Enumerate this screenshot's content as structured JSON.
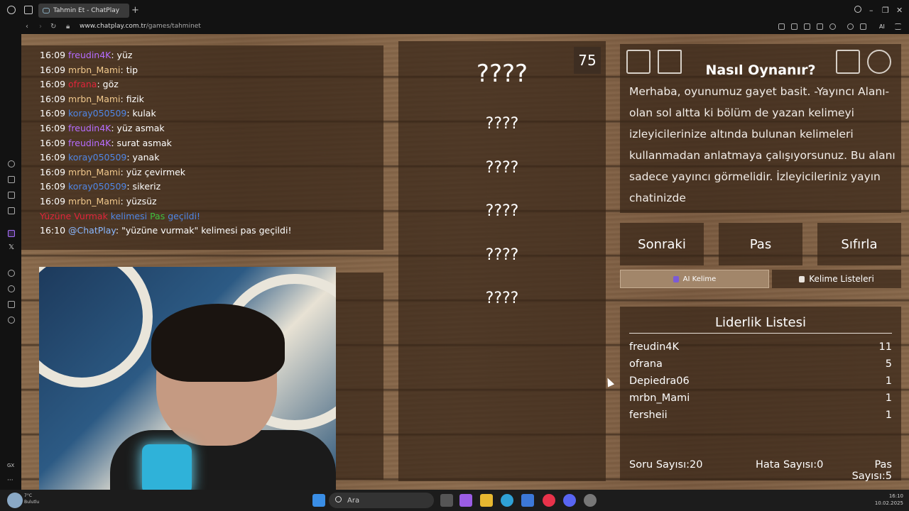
{
  "browser": {
    "tab_title": "Tahmin Et - ChatPlay",
    "tab_plus": "+",
    "url_domain": "www.chatplay.com.tr",
    "url_path": "/games/tahminet",
    "ai_label": "AI",
    "left_gx": "GX"
  },
  "chat": {
    "messages": [
      {
        "time": "16:09",
        "user": "freudin4K",
        "color": "#b66cff",
        "text": ": yüz"
      },
      {
        "time": "16:09",
        "user": "mrbn_Mami",
        "color": "#f0c88c",
        "text": ": tip"
      },
      {
        "time": "16:09",
        "user": "ofrana",
        "color": "#e0253a",
        "text": ": göz"
      },
      {
        "time": "16:09",
        "user": "mrbn_Mami",
        "color": "#f0c88c",
        "text": ": fizik"
      },
      {
        "time": "16:09",
        "user": "koray050509",
        "color": "#4f86e6",
        "text": ": kulak"
      },
      {
        "time": "16:09",
        "user": "freudin4K",
        "color": "#b66cff",
        "text": ": yüz asmak"
      },
      {
        "time": "16:09",
        "user": "freudin4K",
        "color": "#b66cff",
        "text": ": surat asmak"
      },
      {
        "time": "16:09",
        "user": "koray050509",
        "color": "#4f86e6",
        "text": ": yanak"
      },
      {
        "time": "16:09",
        "user": "mrbn_Mami",
        "color": "#f0c88c",
        "text": ": yüz çevirmek"
      },
      {
        "time": "16:09",
        "user": "koray050509",
        "color": "#4f86e6",
        "text": ": sikeriz"
      },
      {
        "time": "16:09",
        "user": "mrbn_Mami",
        "color": "#f0c88c",
        "text": ": yüzsüz"
      }
    ],
    "system_line": {
      "word": "Yüzüne Vurmak",
      "mid": " kelimesi ",
      "pas": "Pas",
      "end": " geçildi!"
    },
    "last_line": {
      "time": "16:10",
      "user": "@ChatPlay",
      "text": ": \"yüzüne vurmak\" kelimesi pas geçildi!"
    }
  },
  "game": {
    "timer": "75",
    "slots": [
      "????",
      "????",
      "????",
      "????",
      "????",
      "????"
    ]
  },
  "howto": {
    "title": "Nasıl Oynanır?",
    "text": "Merhaba, oyunumuz gayet basit. -Yayıncı Alanı- olan sol altta ki bölüm de yazan kelimeyi izleyicilerinize altında bulunan kelimeleri kullanmadan anlatmaya çalışıyorsunuz. Bu alanı sadece yayıncı görmelidir. İzleyicileriniz yayın chatinizde"
  },
  "controls": {
    "next": "Sonraki",
    "pass": "Pas",
    "reset": "Sıfırla",
    "ai_word": "AI Kelime",
    "word_lists": "Kelime Listeleri"
  },
  "leaderboard": {
    "title": "Liderlik Listesi",
    "rows": [
      {
        "name": "freudin4K",
        "score": "11"
      },
      {
        "name": "ofrana",
        "score": "5"
      },
      {
        "name": "Depiedra06",
        "score": "1"
      },
      {
        "name": "mrbn_Mami",
        "score": "1"
      },
      {
        "name": "fersheii",
        "score": "1"
      }
    ],
    "questions_label": "Soru Sayısı:",
    "questions_value": "20",
    "errors_label": "Hata Sayısı:",
    "errors_value": "0",
    "passes_label": "Pas Sayısı:",
    "passes_value": "5"
  },
  "taskbar": {
    "weather_temp": "7°C",
    "weather_desc": "Bulutlu",
    "search_placeholder": "Ara",
    "time": "16:10",
    "date": "10.02.2025"
  }
}
